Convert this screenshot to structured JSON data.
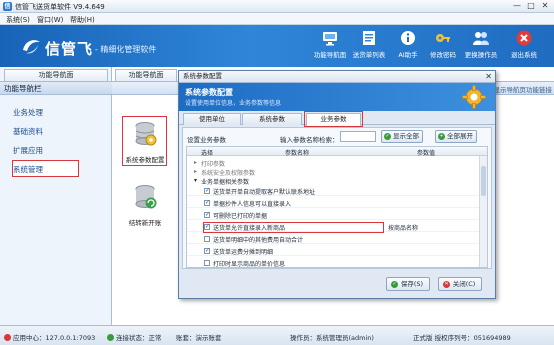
{
  "window": {
    "title": "信管飞送货单软件 V9.4.649",
    "controls": [
      "—",
      "□",
      "✕"
    ]
  },
  "menu": {
    "items": [
      "系统(S)",
      "窗口(W)",
      "帮助(H)"
    ]
  },
  "header": {
    "brand": "信管飞",
    "slogan": "- 精细化管理软件",
    "buttons": [
      {
        "label": "功能导航面",
        "icon": "monitor-icon"
      },
      {
        "label": "送货单列表",
        "icon": "list-icon"
      },
      {
        "label": "AI助手",
        "icon": "info-icon"
      },
      {
        "label": "修改密码",
        "icon": "key-icon"
      },
      {
        "label": "更换操作员",
        "icon": "users-icon"
      },
      {
        "label": "退出系统",
        "icon": "exit-icon"
      }
    ]
  },
  "left_panel": {
    "tab": "功能导航面",
    "heading": "功能导航栏",
    "items": [
      "业务处理",
      "基础资料",
      "扩展应用",
      "系统管理"
    ]
  },
  "content": {
    "tab": "功能导航面",
    "right_link": "显示导航页功能链接",
    "items": [
      {
        "label": "系统参数配置",
        "icon": "database-settings-icon"
      },
      {
        "label": "结转新开账",
        "icon": "database-refresh-icon"
      }
    ]
  },
  "dialog": {
    "title": "系统参数配置",
    "close": "✕",
    "banner_title": "系统参数配置",
    "banner_subtitle": "设置使用单位信息，业务参数等信息",
    "tabs": [
      "使用单位",
      "系统参数",
      "业务参数"
    ],
    "active_tab": "业务参数",
    "set_label": "设置业务参数",
    "search_label": "输入参数名称检索：",
    "search_value": "",
    "show_all": "显示全部",
    "expand_all": "全部展开",
    "columns": [
      "选择",
      "参数名称",
      "参数值"
    ],
    "groups": [
      {
        "arrow": "▸",
        "name": "打印参数"
      },
      {
        "arrow": "▸",
        "name": "系统安全及权限参数"
      },
      {
        "arrow": "▾",
        "name": "业务单据相关参数"
      }
    ],
    "rows": [
      {
        "checked": true,
        "name": "送货单开单自动提取客户默认联系地址",
        "value": ""
      },
      {
        "checked": true,
        "name": "单据抄件人信息可以直接录入",
        "value": ""
      },
      {
        "checked": true,
        "name": "可删除已打印的单据",
        "value": ""
      },
      {
        "checked": true,
        "name": "送货单允许直接录入新商品",
        "value": "按商品名称"
      },
      {
        "checked": false,
        "name": "送货单明细中的其他费用自动合计",
        "value": ""
      },
      {
        "checked": true,
        "name": "送货单运费分摊到明细",
        "value": ""
      },
      {
        "checked": false,
        "name": "打印时显示商品的单价信息",
        "value": ""
      }
    ],
    "save_label": "保存(S)",
    "close_label": "关闭(C)"
  },
  "statusbar": {
    "app_center": "应用中心：127.0.0.1:7093",
    "connection": "连接状态：正常",
    "account": "账套：演示账套",
    "operator": "操作员：系统管理员(admin)",
    "license": "正式版 授权序列号：051694989"
  },
  "colors": {
    "header_blue": "#1f6cc1",
    "highlight_red": "#d9363e",
    "ok_green": "#3a9b3a"
  }
}
